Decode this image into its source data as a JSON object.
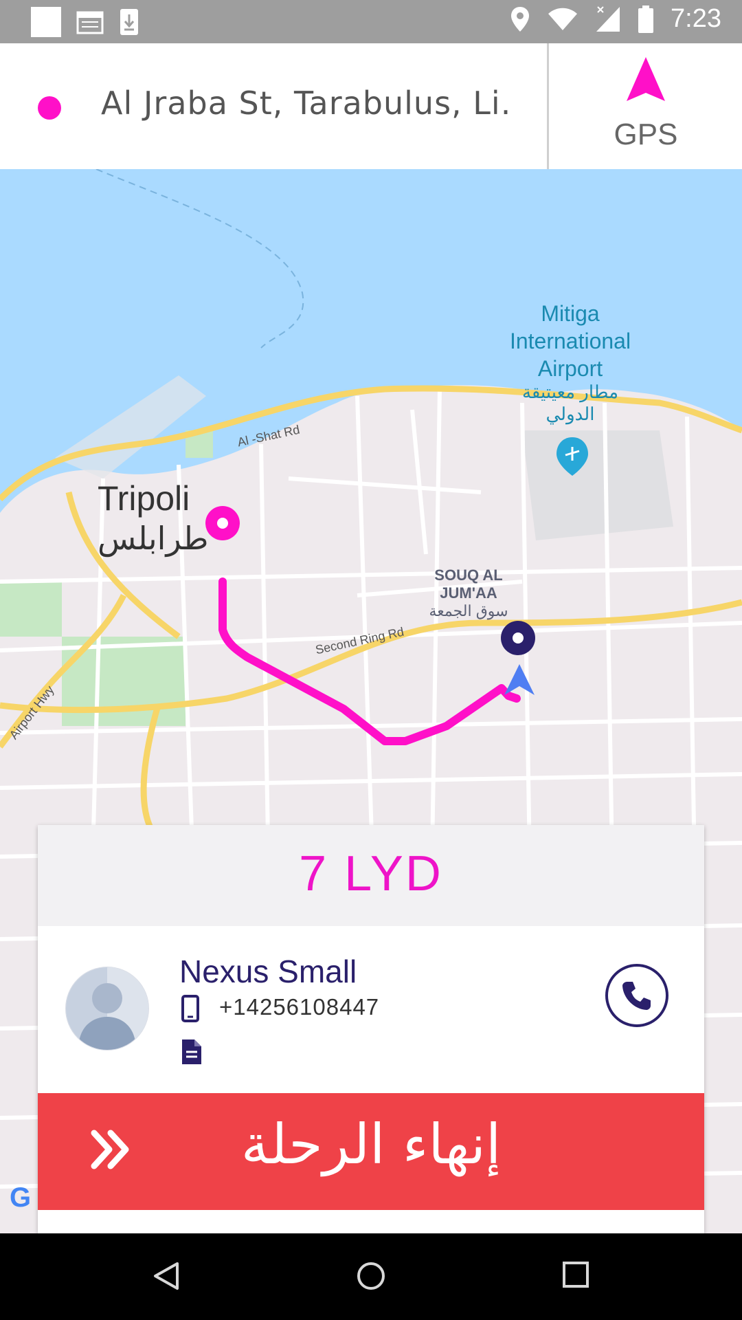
{
  "status_bar": {
    "time": "7:23",
    "icons": [
      "notification-square-icon",
      "calendar-icon",
      "download-icon",
      "location-icon",
      "wifi-icon",
      "signal-icon",
      "battery-icon"
    ]
  },
  "header": {
    "address": "Al Jraba St, Tarabulus, Li...",
    "gps_label": "GPS",
    "accent_color": "#ff10c8"
  },
  "map": {
    "city_label": "Tripoli",
    "city_label_ar": "طرابلس",
    "airport_label": "Mitiga International Airport",
    "airport_label_ar": "مطار معيتيقة الدولي",
    "district_label": "SOUQ AL JUM'AA",
    "district_label_ar": "سوق الجمعة",
    "roads": {
      "al_shat": "Al -Shat Rd",
      "second_ring": "Second Ring Rd",
      "airport_hwy": "Airport Hwy"
    },
    "google_logo": "G",
    "route_color": "#ff10c8"
  },
  "trip_card": {
    "fare": "7 LYD",
    "rider_name": "Nexus Small",
    "rider_phone": "+14256108447",
    "end_trip_label": "إنهاء الرحلة",
    "end_trip_color": "#ef4248",
    "text_color": "#2a206b"
  }
}
